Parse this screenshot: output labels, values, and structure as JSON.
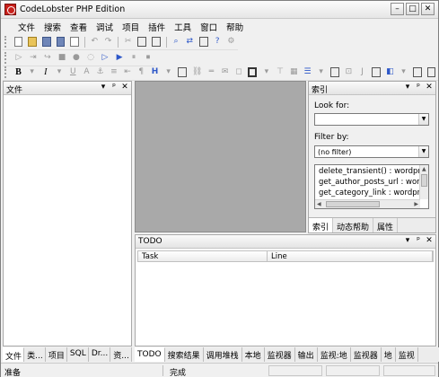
{
  "window": {
    "title": "CodeLobster PHP Edition",
    "buttons": {
      "minimize": "–",
      "maximize": "□",
      "close": "✕"
    }
  },
  "menu": [
    "文件",
    "搜索",
    "查看",
    "调试",
    "项目",
    "插件",
    "工具",
    "窗口",
    "帮助"
  ],
  "panels": {
    "files": {
      "title": "文件"
    },
    "index": {
      "title": "索引",
      "look_for_label": "Look for:",
      "look_for_value": "",
      "filter_label": "Filter by:",
      "filter_value": "(no filter)",
      "items": [
        "delete_transient() : wordpre",
        "get_author_posts_url : word",
        "get_category_link : wordpre"
      ],
      "tabs": [
        "索引",
        "动态帮助",
        "属性"
      ]
    },
    "todo": {
      "title": "TODO",
      "columns": [
        "Task",
        "Line"
      ]
    },
    "controls": {
      "dropdown": "▾",
      "pin": "ᵖ",
      "close": "✕"
    }
  },
  "bottom_tabs_left": [
    "文件",
    "类...",
    "项目",
    "SQL",
    "Dr...",
    "资..."
  ],
  "bottom_tabs_right": [
    "TODO",
    "搜索结果",
    "调用堆栈",
    "本地",
    "监视器",
    "输出",
    "监视:地",
    "监视器",
    "地",
    "监视"
  ],
  "statusbar": {
    "left": "准备",
    "middle": "完成"
  },
  "toolbar": {
    "bold": "B",
    "italic": "I",
    "underline": "U",
    "font": "A",
    "heading": "H"
  },
  "colors": {
    "workspace_gray": "#a9a9a9",
    "app_icon": "#c8201b"
  }
}
